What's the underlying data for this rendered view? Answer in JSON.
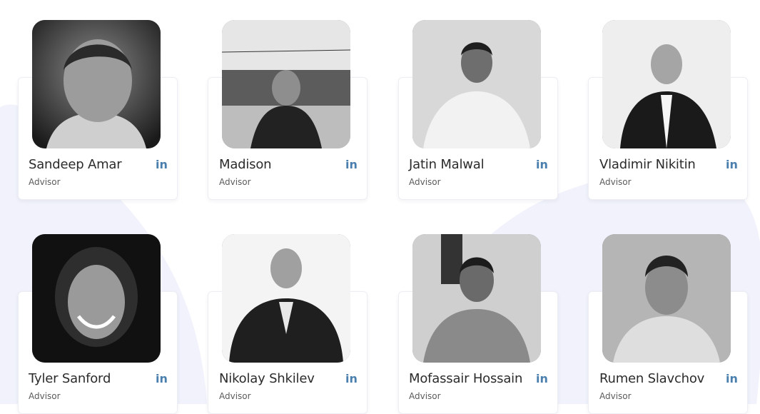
{
  "team": [
    {
      "name": "Sandeep Amar",
      "role": "Advisor",
      "linkedin": "in",
      "photo": "portrait-smiling-man"
    },
    {
      "name": "Madison",
      "role": "Advisor",
      "linkedin": "in",
      "photo": "portrait-outdoor-man"
    },
    {
      "name": "Jatin Malwal",
      "role": "Advisor",
      "linkedin": "in",
      "photo": "portrait-event-man"
    },
    {
      "name": "Vladimir Nikitin",
      "role": "Advisor",
      "linkedin": "in",
      "photo": "portrait-suit-man"
    },
    {
      "name": "Tyler Sanford",
      "role": "Advisor",
      "linkedin": "in",
      "photo": "portrait-curly-hair-man"
    },
    {
      "name": "Nikolay Shkilev",
      "role": "Advisor",
      "linkedin": "in",
      "photo": "portrait-crossed-arms-man"
    },
    {
      "name": "Mofassair Hossain",
      "role": "Advisor",
      "linkedin": "in",
      "photo": "portrait-checked-shirt-man"
    },
    {
      "name": "Rumen Slavchov",
      "role": "Advisor",
      "linkedin": "in",
      "photo": "portrait-short-hair-man"
    }
  ],
  "colors": {
    "accent": "#4a7fad",
    "blob": "#f1f2fb"
  }
}
